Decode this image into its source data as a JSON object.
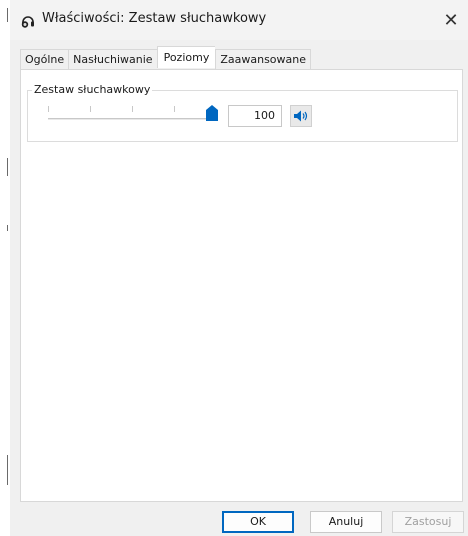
{
  "window": {
    "title": "Właściwości: Zestaw słuchawkowy",
    "close_symbol": "✕",
    "icon": "headset-icon"
  },
  "tabs": [
    {
      "label": "Ogólne",
      "active": false
    },
    {
      "label": "Nasłuchiwanie",
      "active": false
    },
    {
      "label": "Poziomy",
      "active": true
    },
    {
      "label": "Zaawansowane",
      "active": false
    }
  ],
  "levels": {
    "group_label": "Zestaw słuchawkowy",
    "volume_value": "100",
    "volume_fraction": 1.0,
    "mute_icon": "speaker-icon"
  },
  "footer": {
    "ok_label": "OK",
    "cancel_label": "Anuluj",
    "apply_label": "Zastosuj"
  },
  "colors": {
    "accent": "#0067c0",
    "thumb": "#0067c0"
  }
}
